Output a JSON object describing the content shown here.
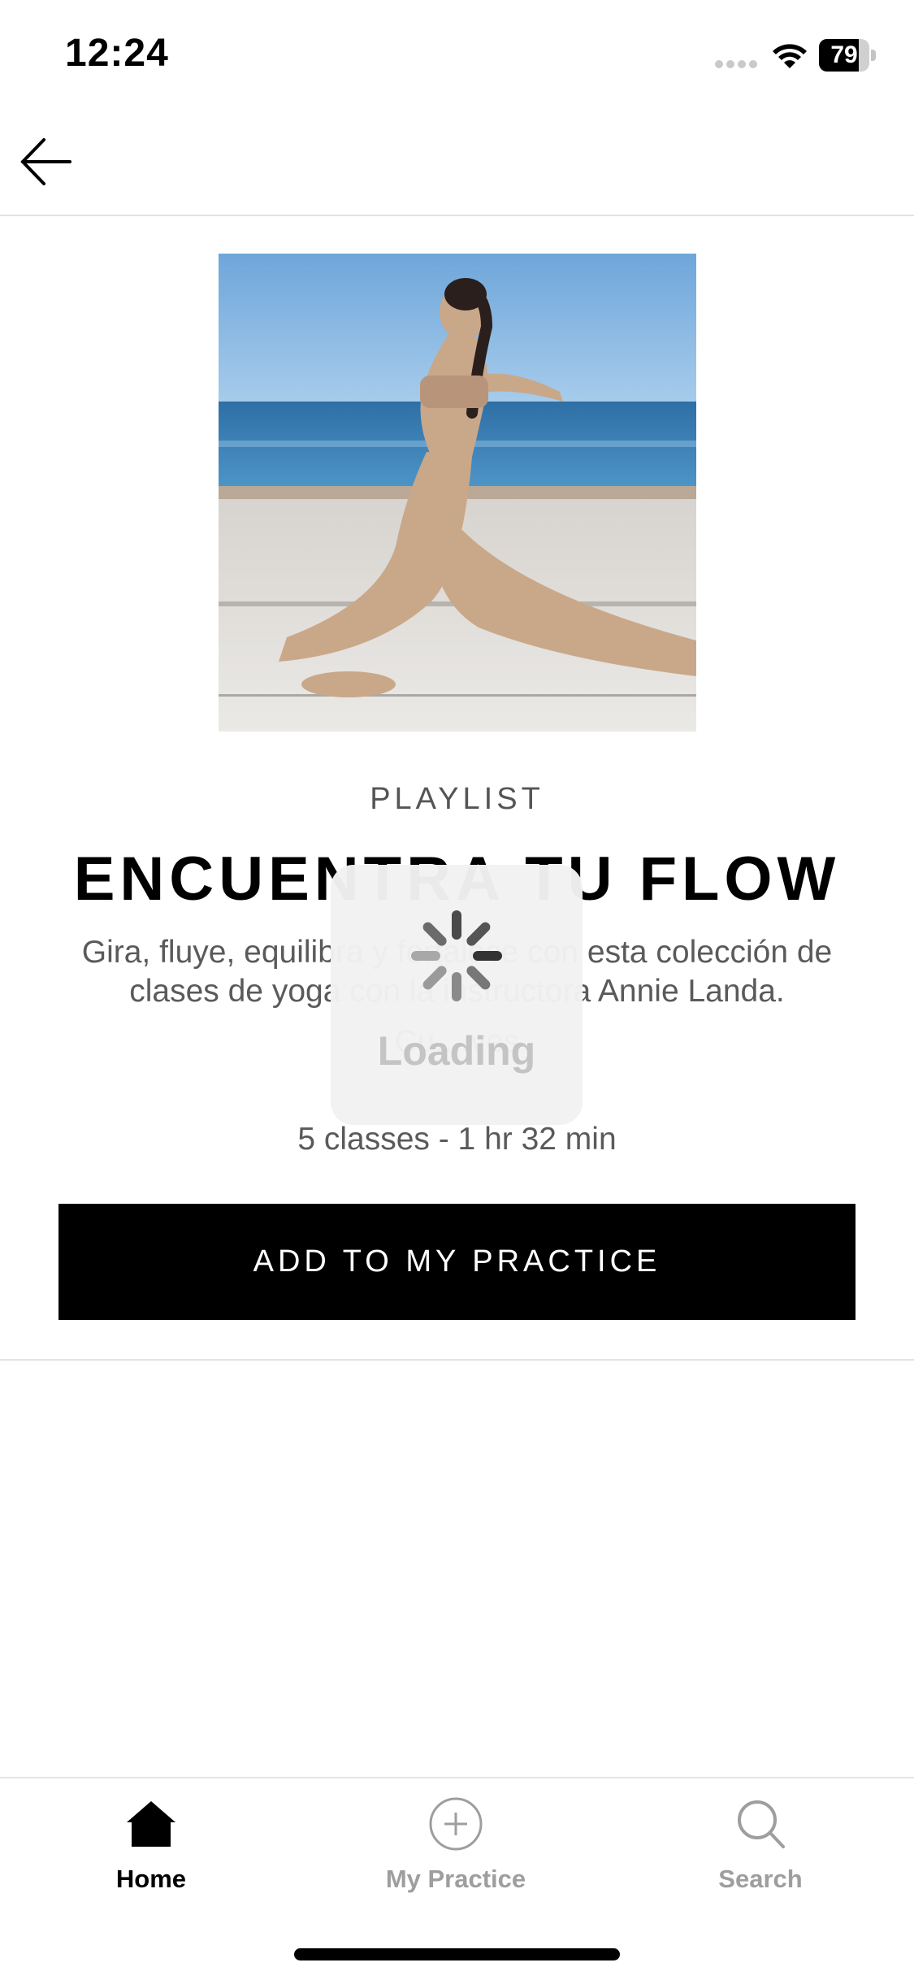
{
  "status_bar": {
    "time": "12:24",
    "battery": "79",
    "battery_level": 0.79
  },
  "header": {
    "back_icon": "arrow-left-icon"
  },
  "playlist": {
    "eyebrow": "PLAYLIST",
    "title": "ENCUENTRA TU FLOW",
    "description": "Gira, fluye, equilibra y fortalece con esta colección de clases de yoga con la instructora Annie Landa.",
    "teacher": "Cu... ves",
    "meta": "5 classes - 1 hr 32 min",
    "add_button": "ADD TO MY PRACTICE"
  },
  "loading": {
    "label": "Loading"
  },
  "tab_bar": {
    "tabs": [
      {
        "label": "Home",
        "icon": "home-icon",
        "active": true
      },
      {
        "label": "My Practice",
        "icon": "plus-circle-icon",
        "active": false
      },
      {
        "label": "Search",
        "icon": "search-icon",
        "active": false
      }
    ],
    "colors": {
      "active": "#000000",
      "inactive": "#9e9e9e"
    }
  }
}
